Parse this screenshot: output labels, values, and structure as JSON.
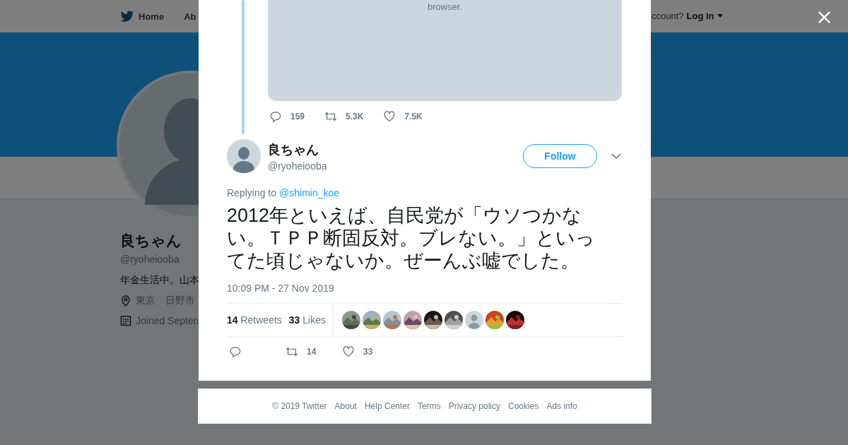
{
  "background_page": {
    "nav": {
      "items": [
        "Home",
        "Ab"
      ],
      "account_prompt": "ccount?",
      "login": "Log in"
    },
    "profile": {
      "name": "良ちゃん",
      "handle": "@ryoheiooba",
      "bio": "年金生活中。山本",
      "location": "東京　日野市",
      "joined": "Joined Septen"
    }
  },
  "modal": {
    "quoted_media": {
      "text": "browser."
    },
    "parent_actions": {
      "replies": "159",
      "retweets": "5.3K",
      "likes": "7.5K"
    },
    "tweet": {
      "name": "良ちゃん",
      "handle": "@ryoheiooba",
      "follow_label": "Follow",
      "replying_prefix": "Replying to",
      "replying_to": "@shimin_koe",
      "text": "2012年といえば、自民党が「ウソつかない。ＴＰＰ断固反対。ブレない。」といってた頃じゃないか。ぜーんぶ嘘でした。",
      "timestamp": "10:09 PM - 27 Nov 2019",
      "stats": [
        {
          "count": "14",
          "label": "Retweets"
        },
        {
          "count": "33",
          "label": "Likes"
        }
      ],
      "likers": [
        {
          "kind": "picture"
        },
        {
          "kind": "picture"
        },
        {
          "kind": "picture"
        },
        {
          "kind": "picture"
        },
        {
          "kind": "picture"
        },
        {
          "kind": "picture"
        },
        {
          "kind": "default"
        },
        {
          "kind": "picture"
        },
        {
          "kind": "picture"
        }
      ],
      "actions": {
        "retweets": "14",
        "likes": "33"
      }
    }
  },
  "footer": {
    "links": [
      "© 2019 Twitter",
      "About",
      "Help Center",
      "Terms",
      "Privacy policy",
      "Cookies",
      "Ads info"
    ]
  }
}
